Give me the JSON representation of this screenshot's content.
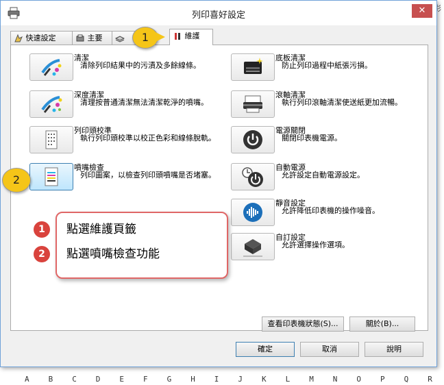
{
  "window": {
    "title": "列印喜好設定",
    "close_label": "✕"
  },
  "tabs": [
    {
      "label": "快速設定"
    },
    {
      "label": "主要"
    },
    {
      "label": ""
    },
    {
      "label": "維護"
    }
  ],
  "left_items": [
    {
      "title": "清潔",
      "desc": "清除列印結果中的污漬及多餘線條。",
      "icon": "print-head-cleaning-icon"
    },
    {
      "title": "深度清潔",
      "desc": "清理按普通清潔無法清潔乾淨的噴嘴。",
      "icon": "deep-cleaning-icon"
    },
    {
      "title": "列印頭校準",
      "desc": "執行列印頭校準以校正色彩和線條脫軌。",
      "icon": "print-head-alignment-icon"
    },
    {
      "title": "噴嘴檢查",
      "desc": "列印圖案，以檢查列印頭噴嘴是否堵塞。",
      "icon": "nozzle-check-icon"
    }
  ],
  "right_items": [
    {
      "title": "底板清潔",
      "desc": "防止列印過程中紙張污損。",
      "icon": "bottom-plate-cleaning-icon"
    },
    {
      "title": "滾軸清潔",
      "desc": "執行列印滾軸清潔使送紙更加流暢。",
      "icon": "roller-cleaning-icon"
    },
    {
      "title": "電源關閉",
      "desc": "關閉印表機電源。",
      "icon": "power-off-icon"
    },
    {
      "title": "自動電源",
      "desc": "允許設定自動電源設定。",
      "icon": "auto-power-icon"
    },
    {
      "title": "靜音設定",
      "desc": "允許降低印表機的操作噪音。",
      "icon": "quiet-settings-icon"
    },
    {
      "title": "自訂設定",
      "desc": "允許選擇操作選項。",
      "icon": "custom-settings-icon"
    }
  ],
  "panel_buttons": {
    "status": "查看印表機狀態(S)...",
    "about": "關於(B)..."
  },
  "dialog_buttons": {
    "ok": "確定",
    "cancel": "取消",
    "help": "說明"
  },
  "callouts": {
    "one": "1",
    "two": "2"
  },
  "note": {
    "rows": [
      {
        "num": "1",
        "text": "點選維護頁籤"
      },
      {
        "num": "2",
        "text": "點選噴嘴檢查功能"
      }
    ]
  },
  "spreadsheet": {
    "columns": [
      "A",
      "B",
      "C",
      "D",
      "E",
      "F",
      "G",
      "H",
      "I",
      "J",
      "K",
      "L",
      "M",
      "N",
      "O",
      "P",
      "Q",
      "R"
    ],
    "side_text": "彩"
  },
  "colors": {
    "accent": "#3c7fb1",
    "callout": "#f5c518",
    "note_border": "#e06666",
    "note_number": "#d9433d",
    "close": "#c75050"
  }
}
